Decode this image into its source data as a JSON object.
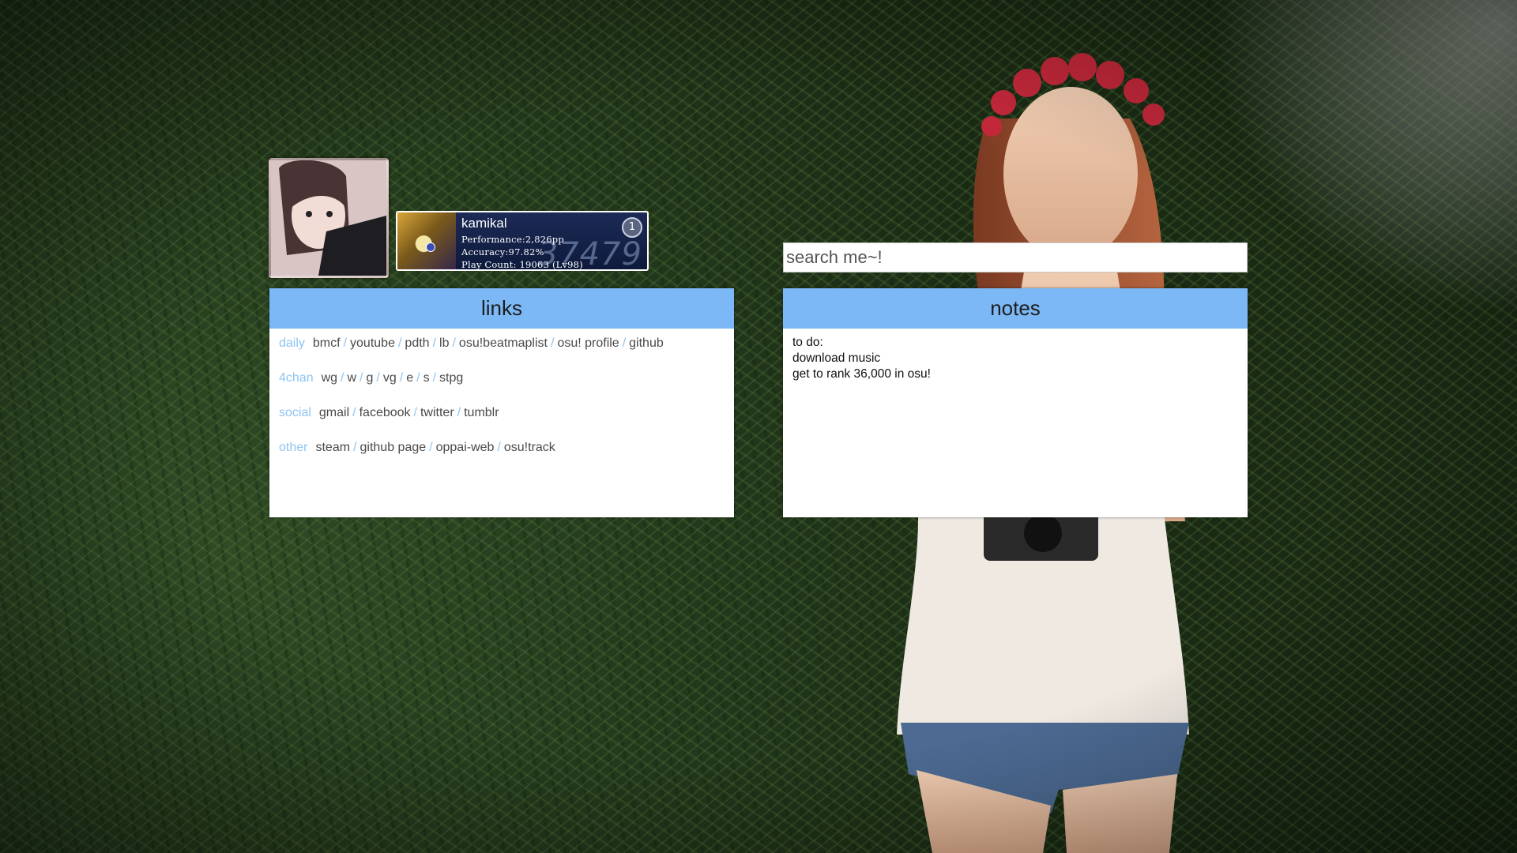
{
  "profile": {
    "avatar_alt": "avatar"
  },
  "osu_card": {
    "username": "kamikal",
    "performance": "Performance:2,826pp",
    "accuracy": "Accuracy:97.82%",
    "play_count": "Play Count: 19063 (Lv98)",
    "rank": "37479",
    "level_badge": "1"
  },
  "search": {
    "placeholder": "search me~!"
  },
  "links_panel": {
    "title": "links",
    "rows": [
      {
        "category": "daily",
        "links": [
          "bmcf",
          "youtube",
          "pdth",
          "lb",
          "osu!beatmaplist",
          "osu! profile",
          "github"
        ]
      },
      {
        "category": "4chan",
        "links": [
          "wg",
          "w",
          "g",
          "vg",
          "e",
          "s",
          "stpg"
        ]
      },
      {
        "category": "social",
        "links": [
          "gmail",
          "facebook",
          "twitter",
          "tumblr"
        ]
      },
      {
        "category": "other",
        "links": [
          "steam",
          "github page",
          "oppai-web",
          "osu!track"
        ]
      }
    ],
    "separator": "/"
  },
  "notes_panel": {
    "title": "notes",
    "lines": [
      "to do:",
      "download music",
      "get to rank 36,000 in osu!"
    ]
  },
  "colors": {
    "panel_header": "#7bb8f5",
    "category": "#8cc4f2",
    "link": "#4a4a4a"
  }
}
